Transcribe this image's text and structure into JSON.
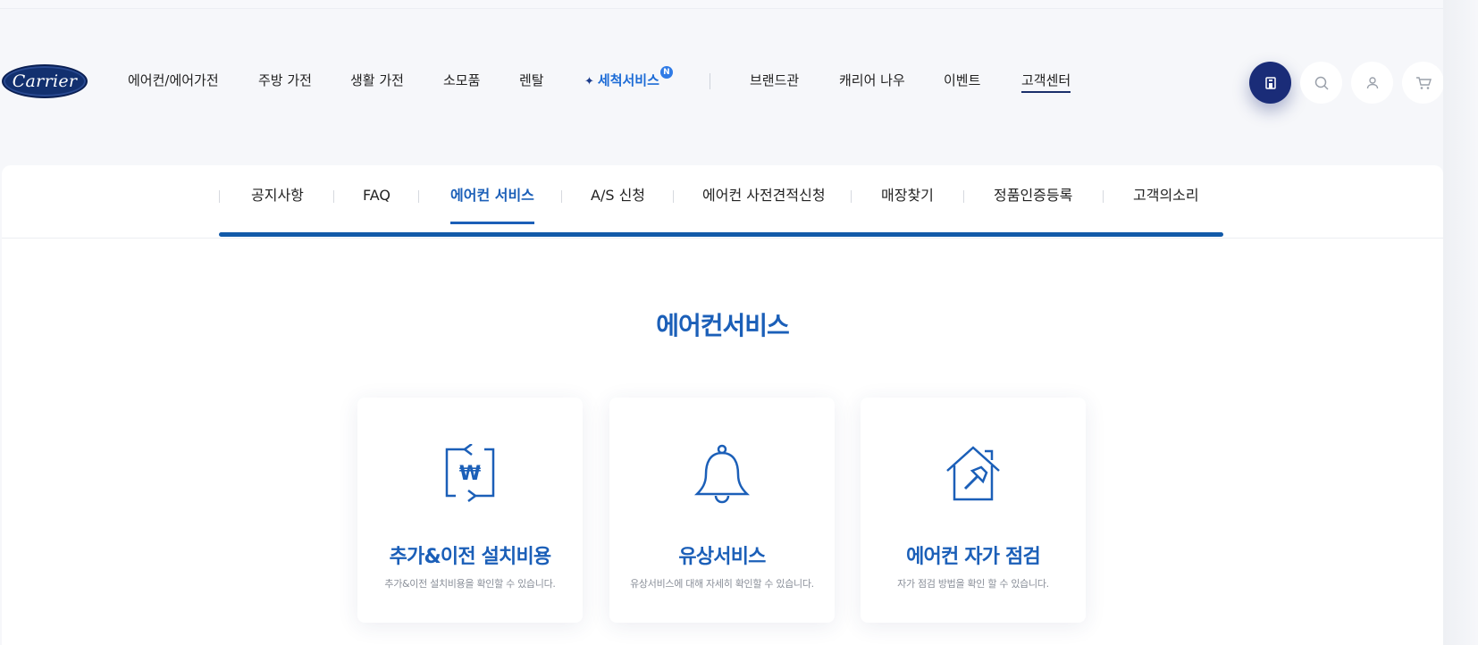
{
  "brand": {
    "logo_text": "Carrier"
  },
  "gnb": {
    "items": [
      {
        "label": "에어컨/에어가전"
      },
      {
        "label": "주방 가전"
      },
      {
        "label": "생활 가전"
      },
      {
        "label": "소모품"
      },
      {
        "label": "렌탈"
      },
      {
        "label": "세척서비스",
        "badge": "N"
      },
      {
        "label": "브랜드관"
      },
      {
        "label": "캐리어 나우"
      },
      {
        "label": "이벤트"
      },
      {
        "label": "고객센터"
      }
    ]
  },
  "utility": {
    "icons": [
      "store-icon",
      "search-icon",
      "user-icon",
      "cart-icon"
    ]
  },
  "lnb": {
    "items": [
      {
        "label": "공지사항"
      },
      {
        "label": "FAQ"
      },
      {
        "label": "에어컨 서비스"
      },
      {
        "label": "A/S 신청"
      },
      {
        "label": "에어컨 사전견적신청"
      },
      {
        "label": "매장찾기"
      },
      {
        "label": "정품인증등록"
      },
      {
        "label": "고객의소리"
      }
    ]
  },
  "section": {
    "title": "에어컨서비스"
  },
  "cards": [
    {
      "title": "추가&이전 설치비용",
      "desc": "추가&이전 설치비용을 확인할 수 있습니다.",
      "icon": "won-transfer-icon"
    },
    {
      "title": "유상서비스",
      "desc": "유상서비스에 대해 자세히 확인할 수 있습니다.",
      "icon": "bell-icon"
    },
    {
      "title": "에어컨 자가 점검",
      "desc": "자가 점검 방법을 확인 할 수 있습니다.",
      "icon": "house-hammer-icon"
    }
  ],
  "colors": {
    "brand_navy": "#1a2c78",
    "accent_blue": "#1b5fb8",
    "link_blue": "#1c6bd6"
  }
}
